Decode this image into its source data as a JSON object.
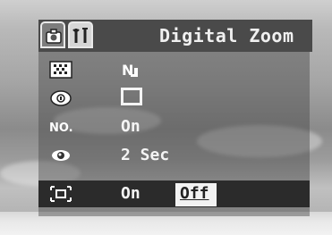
{
  "header": {
    "title": "Digital Zoom",
    "tabs": [
      {
        "icon": "camera-icon",
        "active": true
      },
      {
        "icon": "settings-tools-icon",
        "active": false
      }
    ]
  },
  "menu": {
    "rows": [
      {
        "icon": "resolution-icon",
        "value_icon": "quality-nj-icon"
      },
      {
        "icon": "metering-icon",
        "value_icon": "frame-mode-icon"
      },
      {
        "icon": "number-icon",
        "value": "On"
      },
      {
        "icon": "eye-review-icon",
        "value": "2 Sec"
      },
      {
        "icon": "digital-zoom-icon",
        "value": "On",
        "alt_value": "Off",
        "selected": true
      }
    ]
  }
}
